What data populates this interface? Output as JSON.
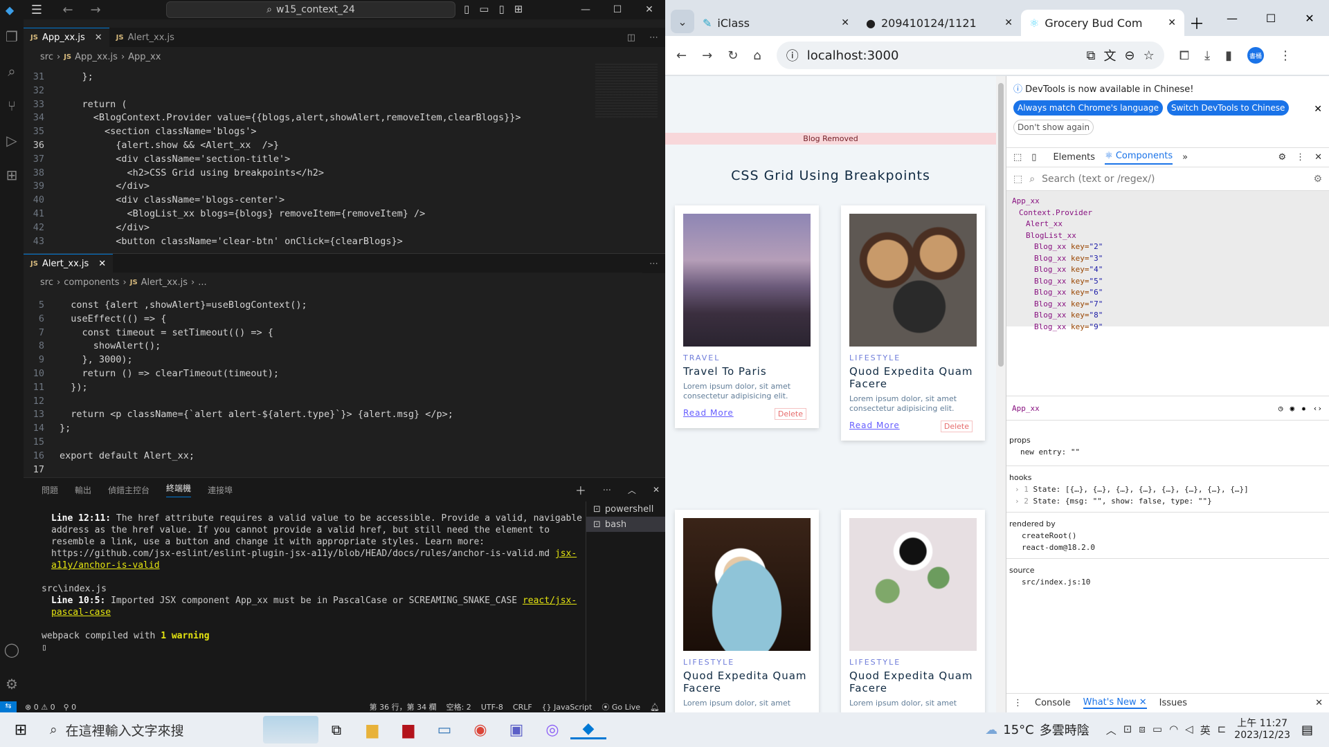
{
  "vscode": {
    "search_text": "w15_context_24",
    "tabs": [
      {
        "label": "App_xx.js",
        "active": true
      },
      {
        "label": "Alert_xx.js",
        "active": false
      }
    ],
    "breadcrumb1": [
      "src",
      "App_xx.js",
      "App_xx"
    ],
    "bottom_tab": "Alert_xx.js",
    "breadcrumb2": [
      "src",
      "components",
      "Alert_xx.js",
      "..."
    ],
    "editor1_lines": [
      {
        "n": "31",
        "t": "    };"
      },
      {
        "n": "32",
        "t": ""
      },
      {
        "n": "33",
        "t": "    return ("
      },
      {
        "n": "34",
        "t": "      <BlogContext.Provider value={{blogs,alert,showAlert,removeItem,clearBlogs}}>"
      },
      {
        "n": "35",
        "t": "        <section className='blogs'>"
      },
      {
        "n": "36",
        "t": "          {alert.show && <Alert_xx  />}"
      },
      {
        "n": "37",
        "t": "          <div className='section-title'>"
      },
      {
        "n": "38",
        "t": "            <h2>CSS Grid using breakpoints</h2>"
      },
      {
        "n": "39",
        "t": "          </div>"
      },
      {
        "n": "40",
        "t": "          <div className='blogs-center'>"
      },
      {
        "n": "41",
        "t": "            <BlogList_xx blogs={blogs} removeItem={removeItem} />"
      },
      {
        "n": "42",
        "t": "          </div>"
      },
      {
        "n": "43",
        "t": "          <button className='clear-btn' onClick={clearBlogs}>"
      }
    ],
    "editor2_lines": [
      {
        "n": "5",
        "t": "  const {alert ,showAlert}=useBlogContext();"
      },
      {
        "n": "6",
        "t": "  useEffect(() => {"
      },
      {
        "n": "7",
        "t": "    const timeout = setTimeout(() => {"
      },
      {
        "n": "8",
        "t": "      showAlert();"
      },
      {
        "n": "9",
        "t": "    }, 3000);"
      },
      {
        "n": "10",
        "t": "    return () => clearTimeout(timeout);"
      },
      {
        "n": "11",
        "t": "  });"
      },
      {
        "n": "12",
        "t": ""
      },
      {
        "n": "13",
        "t": "  return <p className={`alert alert-${alert.type}`}> {alert.msg} </p>;"
      },
      {
        "n": "14",
        "t": "};"
      },
      {
        "n": "15",
        "t": ""
      },
      {
        "n": "16",
        "t": "export default Alert_xx;"
      },
      {
        "n": "17",
        "t": ""
      }
    ],
    "panel_tabs": [
      "問題",
      "輸出",
      "偵錯主控台",
      "終端機",
      "連接埠"
    ],
    "terminal": {
      "l1_head": "Line 12:11:",
      "l1_body": "  The href attribute requires a valid value to be accessible. Provide a valid, navigable address as the href value. If you cannot provide a valid href, but still need the element to resemble a link, use a button and change it with appropriate styles. Learn more: https://github.com/jsx-eslint/eslint-plugin-jsx-a11y/blob/HEAD/docs/rules/anchor-is-valid.md",
      "l1_rule": "jsx-a11y/anchor-is-valid",
      "file2": "src\\index.js",
      "l2_head": "Line 10:5:",
      "l2_body": "  Imported JSX component App_xx must be in PascalCase or SCREAMING_SNAKE_CASE",
      "l2_rule": "react/jsx-pascal-case",
      "compiled_pre": "webpack compiled with ",
      "compiled_warn": "1 warning"
    },
    "terminals": [
      "powershell",
      "bash"
    ],
    "status": {
      "errors": "0",
      "warnings": "0",
      "ports": "0",
      "pos": "第 36 行，第 34 欄",
      "spaces": "空格: 2",
      "enc": "UTF-8",
      "eol": "CRLF",
      "lang": "JavaScript",
      "golive": "Go Live"
    }
  },
  "browser": {
    "tabs": [
      {
        "label": "iClass"
      },
      {
        "label": "209410124/1121"
      },
      {
        "label": "Grocery Bud Com"
      }
    ],
    "url": "localhost:3000",
    "profile": "書桶",
    "page": {
      "alert": "Blog Removed",
      "title": "CSS Grid Using Breakpoints",
      "cards": [
        {
          "cat": "TRAVEL",
          "title": "Travel To Paris",
          "desc": "Lorem ipsum dolor, sit amet consectetur adipisicing elit.",
          "more": "Read More",
          "del": "Delete"
        },
        {
          "cat": "LIFESTYLE",
          "title": "Quod Expedita Quam Facere",
          "desc": "Lorem ipsum dolor, sit amet consectetur adipisicing elit.",
          "more": "Read More",
          "del": "Delete"
        },
        {
          "cat": "LIFESTYLE",
          "title": "Quod Expedita Quam Facere",
          "desc": "Lorem ipsum dolor, sit amet"
        },
        {
          "cat": "LIFESTYLE",
          "title": "Quod Expedita Quam Facere",
          "desc": "Lorem ipsum dolor, sit amet"
        }
      ]
    },
    "devtools": {
      "banner": "DevTools is now available in Chinese!",
      "btn_match": "Always match Chrome's language",
      "btn_switch": "Switch DevTools to Chinese",
      "btn_dont": "Don't show again",
      "tab_elements": "Elements",
      "tab_components": "Components",
      "search_placeholder": "Search (text or /regex/)",
      "tree": [
        {
          "name": "App_xx",
          "key": ""
        },
        {
          "name": "Context.Provider",
          "key": ""
        },
        {
          "name": "Alert_xx",
          "key": ""
        },
        {
          "name": "BlogList_xx",
          "key": ""
        },
        {
          "name": "Blog_xx",
          "key": "\"2\""
        },
        {
          "name": "Blog_xx",
          "key": "\"3\""
        },
        {
          "name": "Blog_xx",
          "key": "\"4\""
        },
        {
          "name": "Blog_xx",
          "key": "\"5\""
        },
        {
          "name": "Blog_xx",
          "key": "\"6\""
        },
        {
          "name": "Blog_xx",
          "key": "\"7\""
        },
        {
          "name": "Blog_xx",
          "key": "\"8\""
        },
        {
          "name": "Blog_xx",
          "key": "\"9\""
        }
      ],
      "selected": "App_xx",
      "props_label": "props",
      "prop_new_entry": "new entry: \"\"",
      "hooks_label": "hooks",
      "hook1": "State: [{…}, {…}, {…}, {…}, {…}, {…}, {…}, {…}]",
      "hook2": "State: {msg: \"\", show: false, type: \"\"}",
      "rendered_label": "rendered by",
      "rendered1": "createRoot()",
      "rendered2": "react-dom@18.2.0",
      "source_label": "source",
      "source_val": "src/index.js:10",
      "drawer": [
        "Console",
        "What's New",
        "Issues"
      ]
    }
  },
  "taskbar": {
    "search_placeholder": "在這裡輸入文字來搜",
    "weather_temp": "15°C",
    "weather_desc": "多雲時陰",
    "ime": "英",
    "time": "上午 11:27",
    "date": "2023/12/23"
  }
}
